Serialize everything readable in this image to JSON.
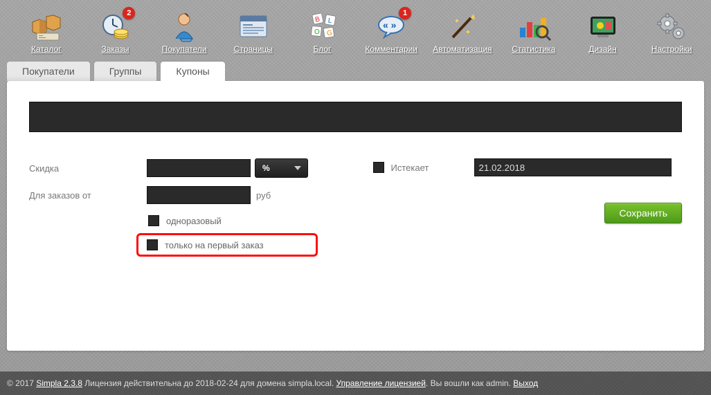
{
  "nav": {
    "catalog": {
      "label": "Каталог",
      "badge": null
    },
    "orders": {
      "label": "Заказы",
      "badge": "2"
    },
    "customers": {
      "label": "Покупатели",
      "badge": null
    },
    "pages": {
      "label": "Страницы",
      "badge": null
    },
    "blog": {
      "label": "Блог",
      "badge": null
    },
    "comments": {
      "label": "Комментарии",
      "badge": "1"
    },
    "automation": {
      "label": "Автоматизация",
      "badge": null
    },
    "stats": {
      "label": "Статистика",
      "badge": null
    },
    "design": {
      "label": "Дизайн",
      "badge": null
    },
    "settings": {
      "label": "Настройки",
      "badge": null
    }
  },
  "tabs": {
    "customers": "Покупатели",
    "groups": "Группы",
    "coupons": "Купоны"
  },
  "form": {
    "code_value": "",
    "discount_label": "Скидка",
    "discount_value": "",
    "discount_type": "%",
    "minorder_label": "Для заказов от",
    "minorder_value": "",
    "minorder_unit": "руб",
    "single_use_label": "одноразовый",
    "single_use_checked": false,
    "first_order_label": "только на первый заказ",
    "first_order_checked": false,
    "expires_label": "Истекает",
    "expires_checked": false,
    "expires_value": "21.02.2018",
    "save_label": "Сохранить"
  },
  "footer": {
    "copyright_prefix": "© 2017 ",
    "product": "Simpla 2.3.8",
    "license_text": " Лицензия действительна до 2018-02-24 для домена simpla.local. ",
    "manage_license": "Управление лицензией",
    "loggedin_text": ". Вы вошли как admin. ",
    "logout": "Выход"
  }
}
